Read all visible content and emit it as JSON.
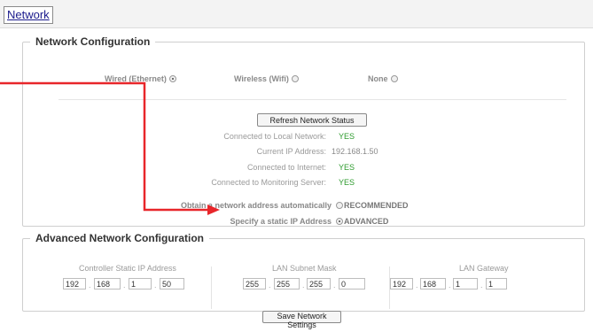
{
  "tab": {
    "label": "Network"
  },
  "network_config": {
    "legend": "Network Configuration",
    "connection_options": [
      {
        "label": "Wired (Ethernet)",
        "selected": true
      },
      {
        "label": "Wireless (Wifi)",
        "selected": false
      },
      {
        "label": "None",
        "selected": false
      }
    ],
    "refresh_label": "Refresh Network Status",
    "status": [
      {
        "label": "Connected to Local Network:",
        "value": "YES",
        "kind": "ok"
      },
      {
        "label": "Current IP Address:",
        "value": "192.168.1.50",
        "kind": "ip"
      },
      {
        "label": "Connected to Internet:",
        "value": "YES",
        "kind": "ok"
      },
      {
        "label": "Connected to Monitoring Server:",
        "value": "YES",
        "kind": "ok"
      }
    ],
    "address_modes": [
      {
        "label": "Obtain a network address automatically",
        "tag": "RECOMMENDED",
        "selected": false
      },
      {
        "label": "Specify a static IP Address",
        "tag": "ADVANCED",
        "selected": true
      }
    ]
  },
  "advanced_config": {
    "legend": "Advanced Network Configuration",
    "columns": [
      {
        "title": "Controller Static IP Address",
        "octets": [
          "192",
          "168",
          "1",
          "50"
        ]
      },
      {
        "title": "LAN Subnet Mask",
        "octets": [
          "255",
          "255",
          "255",
          "0"
        ]
      },
      {
        "title": "LAN Gateway",
        "octets": [
          "192",
          "168",
          "1",
          "1"
        ]
      }
    ]
  },
  "save_label": "Save Network Settings",
  "colors": {
    "arrow": "#e8262a",
    "ok": "#2e9b2e"
  }
}
